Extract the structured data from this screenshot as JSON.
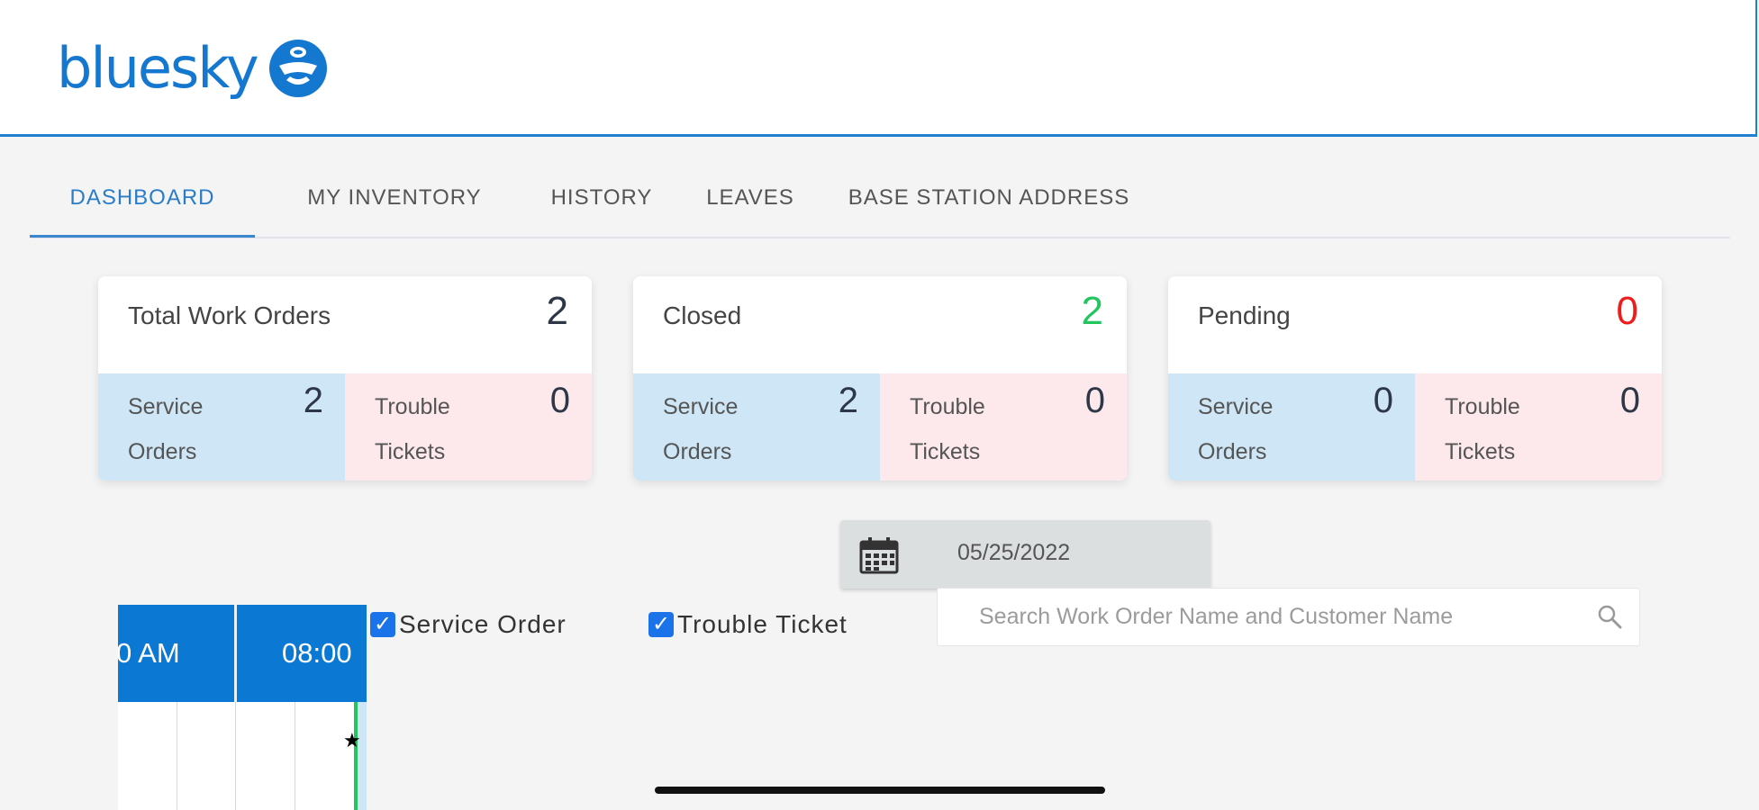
{
  "brand": {
    "name": "bluesky",
    "color": "#1477d0"
  },
  "tabs": [
    {
      "label": "DASHBOARD",
      "active": true
    },
    {
      "label": "MY INVENTORY",
      "active": false
    },
    {
      "label": "HISTORY",
      "active": false
    },
    {
      "label": "LEAVES",
      "active": false
    },
    {
      "label": "BASE STATION ADDRESS",
      "active": false
    }
  ],
  "summary_cards": [
    {
      "title": "Total Work Orders",
      "count": "2",
      "count_color": "#2d3748",
      "service_orders_label": "Service Orders",
      "service_orders": "2",
      "trouble_tickets_label": "Trouble Tickets",
      "trouble_tickets": "0"
    },
    {
      "title": "Closed",
      "count": "2",
      "count_color": "#22c55e",
      "service_orders_label": "Service Orders",
      "service_orders": "2",
      "trouble_tickets_label": "Trouble Tickets",
      "trouble_tickets": "0"
    },
    {
      "title": "Pending",
      "count": "0",
      "count_color": "#ef1c1c",
      "service_orders_label": "Service Orders",
      "service_orders": "0",
      "trouble_tickets_label": "Trouble Tickets",
      "trouble_tickets": "0"
    }
  ],
  "date_picker": {
    "value": "05/25/2022",
    "icon": "calendar-icon"
  },
  "filters": [
    {
      "label": "Service Order",
      "checked": true
    },
    {
      "label": "Trouble Ticket",
      "checked": true
    }
  ],
  "search": {
    "placeholder": "Search Work Order Name and Customer Name",
    "value": "",
    "icon": "search-icon"
  },
  "schedule": {
    "time_labels": [
      "0 AM",
      "08:00"
    ]
  }
}
